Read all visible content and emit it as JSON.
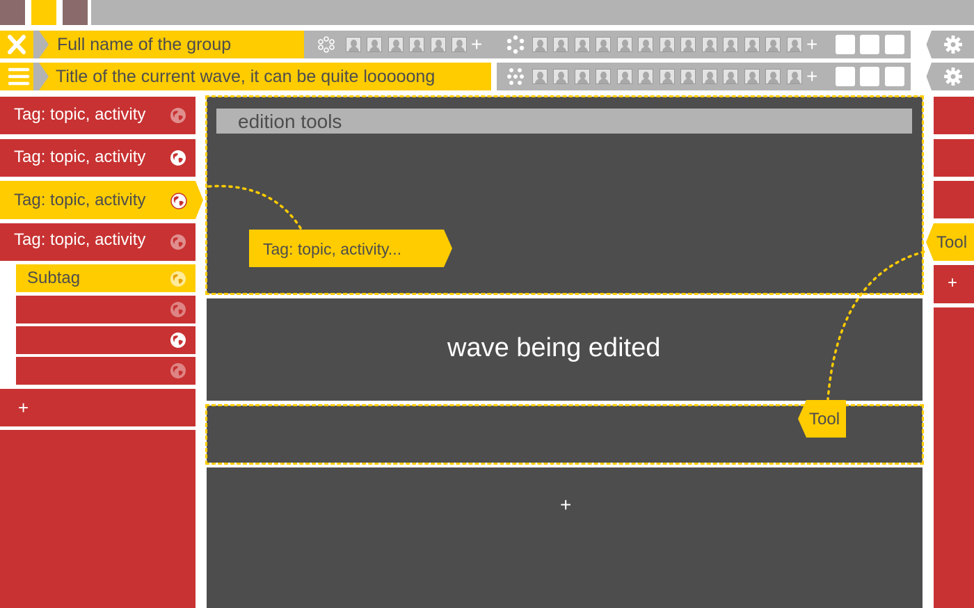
{
  "top_bar": {
    "tabs": [
      "tab-1",
      "tab-2",
      "tab-3"
    ]
  },
  "group_bar": {
    "title": "Full name of the group",
    "plus_1": "+",
    "plus_2": "+"
  },
  "wave_bar": {
    "title": "Title of the current wave, it can be quite looooong",
    "plus": "+"
  },
  "sidebar": {
    "tags": [
      {
        "label": "Tag: topic, activity"
      },
      {
        "label": "Tag: topic, activity"
      },
      {
        "label": "Tag: topic, activity"
      },
      {
        "label": "Tag: topic, activity"
      }
    ],
    "subtag": "Subtag",
    "add": "+"
  },
  "main": {
    "edition_tools": "edition tools",
    "tag_bubble": "Tag: topic, activity...",
    "wave_text": "wave being edited",
    "tool_label": "Tool",
    "add": "+"
  },
  "right_bar": {
    "tool_label": "Tool",
    "add": "+"
  },
  "colors": {
    "accent": "#ffcc00",
    "red": "#c83232",
    "dark": "#4d4d4d",
    "gray": "#b3b3b3"
  }
}
